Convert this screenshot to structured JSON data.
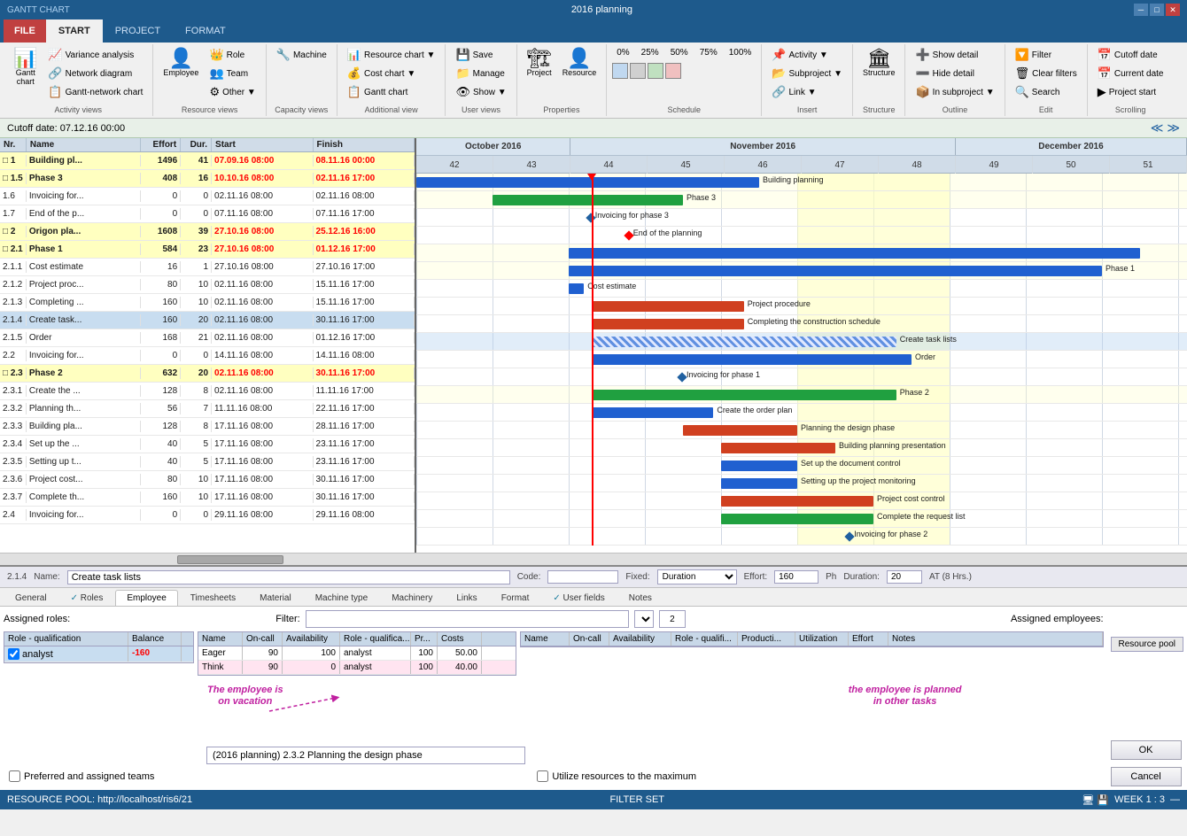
{
  "app": {
    "title": "GANTT CHART",
    "window_title": "2016 planning",
    "file_tab": "FILE",
    "tabs": [
      "START",
      "PROJECT",
      "FORMAT"
    ]
  },
  "ribbon": {
    "groups": [
      {
        "label": "Activity views",
        "items": [
          "Gantt chart"
        ],
        "small_items": [
          "Variance analysis",
          "Network diagram",
          "Gantt-network chart"
        ]
      },
      {
        "label": "Resource views",
        "items": [
          "Employee"
        ],
        "small_items": [
          "Role",
          "Team",
          "Other ▼"
        ]
      },
      {
        "label": "Capacity views",
        "items": [],
        "small_items": [
          "Machine"
        ]
      },
      {
        "label": "Additional view",
        "small_items": [
          "Resource chart ▼",
          "Cost chart ▼",
          "Gantt chart"
        ]
      },
      {
        "label": "User views",
        "small_items": [
          "Save",
          "Manage",
          "Show ▼"
        ]
      },
      {
        "label": "Properties",
        "items": [
          "Project",
          "Resource"
        ]
      },
      {
        "label": "Schedule",
        "small_items": [
          "0%",
          "25%",
          "50%",
          "75%",
          "100%"
        ]
      },
      {
        "label": "Insert",
        "small_items": [
          "Activity ▼",
          "Subproject ▼",
          "Link ▼"
        ]
      },
      {
        "label": "Structure",
        "items": [
          "Structure"
        ]
      },
      {
        "label": "Outline",
        "small_items": [
          "Show detail",
          "Hide detail",
          "In subproject ▼"
        ]
      },
      {
        "label": "Edit",
        "small_items": [
          "Filter",
          "Clear filters",
          "Search"
        ]
      },
      {
        "label": "Scrolling",
        "small_items": [
          "Cutoff date",
          "Current date",
          "Project start"
        ]
      }
    ]
  },
  "cutoff_date_label": "Cutoff date: 07.12.16 00:00",
  "gantt_columns": {
    "nr": "Nr.",
    "name": "Name",
    "effort": "Effort",
    "duration": "Dur.",
    "start": "Start",
    "finish": "Finish"
  },
  "gantt_rows": [
    {
      "nr": "□ 1",
      "name": "Building pl...",
      "effort": "1496",
      "dur": "41",
      "start": "07.09.16 08:00",
      "finish": "08.11.16 00:00",
      "style": "bold",
      "bar_color": "blue",
      "bar_label": "Building planning"
    },
    {
      "nr": "□ 1.5",
      "name": "Phase 3",
      "effort": "408",
      "dur": "16",
      "start": "10.10.16 08:00",
      "finish": "02.11.16 17:00",
      "style": "phase",
      "bar_color": "green",
      "bar_label": "Phase 3"
    },
    {
      "nr": "1.6",
      "name": "Invoicing for...",
      "effort": "0",
      "dur": "0",
      "start": "02.11.16 08:00",
      "finish": "02.11.16 08:00",
      "style": "normal",
      "bar_label": "Invoicing for phase 3"
    },
    {
      "nr": "1.7",
      "name": "End of the p...",
      "effort": "0",
      "dur": "0",
      "start": "07.11.16 08:00",
      "finish": "07.11.16 17:00",
      "style": "normal",
      "bar_label": "End of the planning"
    },
    {
      "nr": "□ 2",
      "name": "Origon pla...",
      "effort": "1608",
      "dur": "39",
      "start": "27.10.16 08:00",
      "finish": "25.12.16 16:00",
      "style": "bold",
      "bar_color": "blue"
    },
    {
      "nr": "□ 2.1",
      "name": "Phase 1",
      "effort": "584",
      "dur": "23",
      "start": "27.10.16 08:00",
      "finish": "01.12.16 17:00",
      "style": "phase",
      "bar_color": "blue",
      "bar_label": "Phase 1"
    },
    {
      "nr": "2.1.1",
      "name": "Cost estimate",
      "effort": "16",
      "dur": "1",
      "start": "27.10.16 08:00",
      "finish": "27.10.16 17:00",
      "style": "normal",
      "bar_label": "Cost estimate"
    },
    {
      "nr": "2.1.2",
      "name": "Project proc...",
      "effort": "80",
      "dur": "10",
      "start": "02.11.16 08:00",
      "finish": "15.11.16 17:00",
      "style": "normal",
      "bar_color": "red",
      "bar_label": "Project procedure"
    },
    {
      "nr": "2.1.3",
      "name": "Completing ...",
      "effort": "160",
      "dur": "10",
      "start": "02.11.16 08:00",
      "finish": "15.11.16 17:00",
      "style": "normal",
      "bar_color": "red",
      "bar_label": "Completing the construction schedule"
    },
    {
      "nr": "2.1.4",
      "name": "Create task...",
      "effort": "160",
      "dur": "20",
      "start": "02.11.16 08:00",
      "finish": "30.11.16 17:00",
      "style": "selected",
      "bar_color": "hatch",
      "bar_label": "Create task lists"
    },
    {
      "nr": "2.1.5",
      "name": "Order",
      "effort": "168",
      "dur": "21",
      "start": "02.11.16 08:00",
      "finish": "01.12.16 17:00",
      "style": "normal",
      "bar_color": "blue",
      "bar_label": "Order"
    },
    {
      "nr": "2.2",
      "name": "Invoicing for...",
      "effort": "0",
      "dur": "0",
      "start": "14.11.16 08:00",
      "finish": "14.11.16 08:00",
      "style": "normal",
      "bar_label": "Invoicing for phase 1"
    },
    {
      "nr": "□ 2.3",
      "name": "Phase 2",
      "effort": "632",
      "dur": "20",
      "start": "02.11.16 08:00",
      "finish": "30.11.16 17:00",
      "style": "phase",
      "bar_color": "green",
      "bar_label": "Phase 2"
    },
    {
      "nr": "2.3.1",
      "name": "Create the ...",
      "effort": "128",
      "dur": "8",
      "start": "02.11.16 08:00",
      "finish": "11.11.16 17:00",
      "style": "normal",
      "bar_color": "blue",
      "bar_label": "Create the order plan"
    },
    {
      "nr": "2.3.2",
      "name": "Planning th...",
      "effort": "56",
      "dur": "7",
      "start": "11.11.16 08:00",
      "finish": "22.11.16 17:00",
      "style": "normal",
      "bar_color": "red",
      "bar_label": "Planning the design phase"
    },
    {
      "nr": "2.3.3",
      "name": "Building pla...",
      "effort": "128",
      "dur": "8",
      "start": "17.11.16 08:00",
      "finish": "28.11.16 17:00",
      "style": "normal",
      "bar_color": "red",
      "bar_label": "Building planning presentation"
    },
    {
      "nr": "2.3.4",
      "name": "Set up the ...",
      "effort": "40",
      "dur": "5",
      "start": "17.11.16 08:00",
      "finish": "23.11.16 17:00",
      "style": "normal",
      "bar_color": "blue",
      "bar_label": "Set up the document control"
    },
    {
      "nr": "2.3.5",
      "name": "Setting up t...",
      "effort": "40",
      "dur": "5",
      "start": "17.11.16 08:00",
      "finish": "23.11.16 17:00",
      "style": "normal",
      "bar_color": "blue",
      "bar_label": "Setting up the project monitoring"
    },
    {
      "nr": "2.3.6",
      "name": "Project cost...",
      "effort": "80",
      "dur": "10",
      "start": "17.11.16 08:00",
      "finish": "30.11.16 17:00",
      "style": "normal",
      "bar_color": "red",
      "bar_label": "Project cost control"
    },
    {
      "nr": "2.3.7",
      "name": "Complete th...",
      "effort": "160",
      "dur": "10",
      "start": "17.11.16 08:00",
      "finish": "30.11.16 17:00",
      "style": "normal",
      "bar_color": "green",
      "bar_label": "Complete the request list"
    },
    {
      "nr": "2.4",
      "name": "Invoicing for...",
      "effort": "0",
      "dur": "0",
      "start": "29.11.16 08:00",
      "finish": "29.11.16 08:00",
      "style": "normal",
      "bar_label": "Invoicing for phase 2"
    }
  ],
  "chart_months": [
    {
      "label": "October 2016",
      "weeks": [
        "42",
        "43"
      ]
    },
    {
      "label": "November 2016",
      "weeks": [
        "44",
        "45",
        "46",
        "47",
        "48"
      ]
    },
    {
      "label": "December 2016",
      "weeks": [
        "49",
        "50",
        "51"
      ]
    }
  ],
  "task_panel": {
    "id": "2.1.4",
    "name_label": "Name:",
    "name_value": "Create task lists",
    "code_label": "Code:",
    "fixed_label": "Fixed:",
    "fixed_value": "Duration",
    "effort_label": "Effort:",
    "effort_value": "160",
    "ph_label": "Ph",
    "duration_label": "Duration:",
    "duration_value": "20",
    "at_label": "AT (8 Hrs.)"
  },
  "tabs": [
    "General",
    "Roles",
    "Employee",
    "Timesheets",
    "Material",
    "Machine type",
    "Machinery",
    "Links",
    "Format",
    "User fields",
    "Notes"
  ],
  "active_tab": "Employee",
  "employee_panel": {
    "assigned_roles_label": "Assigned roles:",
    "filter_label": "Filter:",
    "filter_value": "",
    "filter_num": "2",
    "assigned_employees_label": "Assigned employees:",
    "resource_pool_btn": "Resource pool",
    "roles_table": {
      "headers": [
        "Role - qualification",
        "Balance"
      ],
      "rows": [
        {
          "role": "analyst",
          "balance": "-160",
          "checked": true
        }
      ]
    },
    "candidates_table": {
      "headers": [
        "Name",
        "On-call",
        "Availability",
        "Role - qualifica...",
        "Pr...",
        "Costs"
      ],
      "rows": [
        {
          "name": "Eager",
          "oncall": "90",
          "avail": "100",
          "role": "analyst",
          "pr": "100",
          "costs": "50.00",
          "style": "normal"
        },
        {
          "name": "Think",
          "oncall": "90",
          "avail": "0",
          "role": "analyst",
          "pr": "100",
          "costs": "40.00",
          "style": "pink"
        }
      ]
    },
    "assigned_table": {
      "headers": [
        "Name",
        "On-call",
        "Availability",
        "Role - qualifi...",
        "Producti...",
        "Utilization",
        "Effort",
        "Notes"
      ],
      "rows": []
    },
    "annotation1": "The employee is\non vacation",
    "annotation2": "the employee is planned\nin other tasks",
    "tooltip_text": "(2016 planning) 2.3.2 Planning the design phase",
    "preferred_label": "Preferred and assigned teams",
    "utilize_label": "Utilize resources to the maximum"
  },
  "status_bar": {
    "left": "RESOURCE POOL: http://localhost/ris6/21",
    "middle": "FILTER SET",
    "right": "WEEK 1 : 3"
  },
  "buttons": {
    "ok": "OK",
    "cancel": "Cancel"
  }
}
